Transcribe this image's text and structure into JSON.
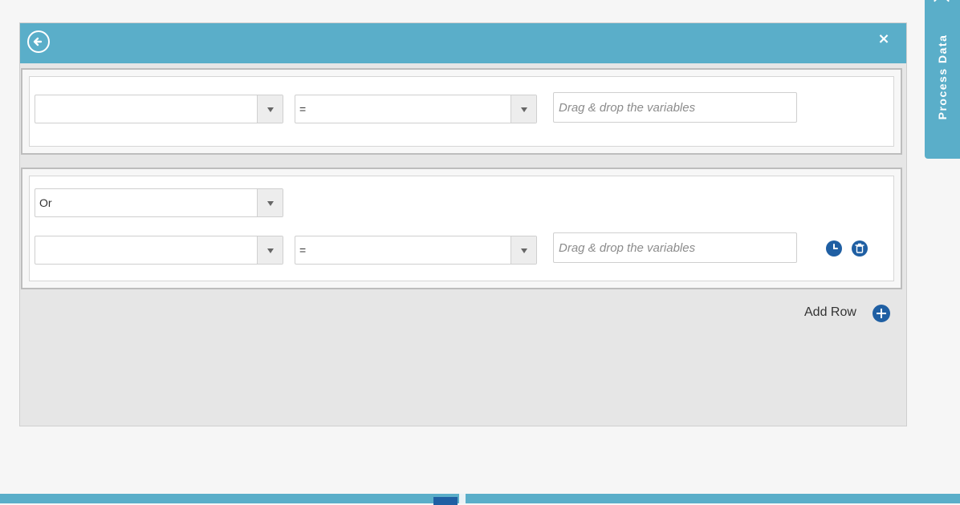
{
  "side_tab": {
    "label": "Process Data"
  },
  "dialog": {
    "back_icon": "back-arrow-icon",
    "close_label": "×",
    "groups": [
      {
        "rows": [
          {
            "field": "",
            "operator": "=",
            "value_placeholder": "Drag & drop the variables"
          }
        ]
      },
      {
        "logic": "Or",
        "rows": [
          {
            "field": "",
            "operator": "=",
            "value_placeholder": "Drag & drop the variables"
          }
        ],
        "row_actions": [
          "history-icon",
          "trash-icon"
        ]
      }
    ],
    "add_row_label": "Add Row",
    "add_row_icon": "plus-circle-icon"
  },
  "colors": {
    "header": "#5aaec9",
    "accent": "#1f5fa3",
    "panel": "#e6e6e6"
  }
}
